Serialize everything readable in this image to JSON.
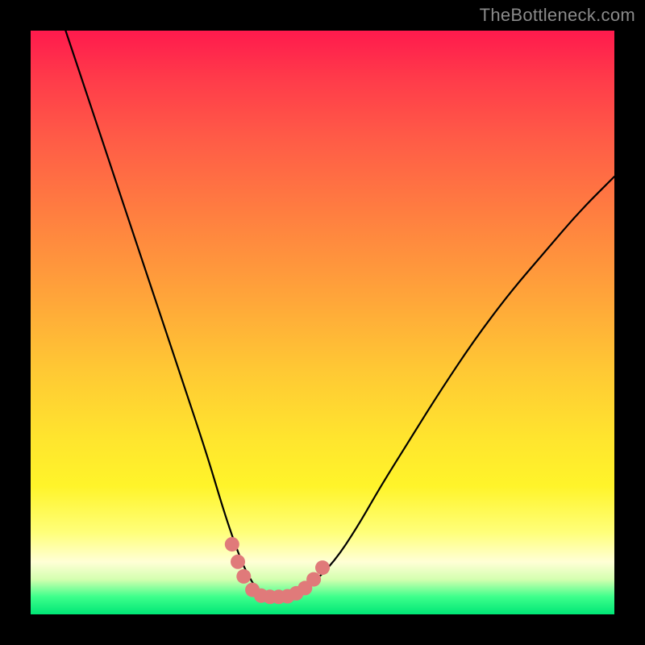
{
  "watermark": "TheBottleneck.com",
  "chart_data": {
    "type": "line",
    "title": "",
    "xlabel": "",
    "ylabel": "",
    "xlim": [
      0,
      100
    ],
    "ylim": [
      0,
      100
    ],
    "series": [
      {
        "name": "bottleneck-curve",
        "x": [
          6,
          10,
          14,
          18,
          22,
          26,
          30,
          33,
          35,
          37,
          39,
          41,
          43,
          45,
          48,
          52,
          56,
          60,
          65,
          70,
          76,
          82,
          88,
          94,
          100
        ],
        "values": [
          100,
          88,
          76,
          64,
          52,
          40,
          28,
          18,
          12,
          7,
          4,
          3,
          3,
          3.5,
          5,
          9,
          15,
          22,
          30,
          38,
          47,
          55,
          62,
          69,
          75
        ]
      }
    ],
    "markers": {
      "name": "highlight-band",
      "color": "#e07a7a",
      "points": [
        {
          "x": 34.5,
          "y": 12
        },
        {
          "x": 35.5,
          "y": 9
        },
        {
          "x": 36.5,
          "y": 6.5
        },
        {
          "x": 38,
          "y": 4.2
        },
        {
          "x": 39.5,
          "y": 3.2
        },
        {
          "x": 41,
          "y": 3
        },
        {
          "x": 42.5,
          "y": 3
        },
        {
          "x": 44,
          "y": 3.1
        },
        {
          "x": 45.5,
          "y": 3.6
        },
        {
          "x": 47,
          "y": 4.5
        },
        {
          "x": 48.5,
          "y": 6
        },
        {
          "x": 50,
          "y": 8
        }
      ]
    }
  }
}
